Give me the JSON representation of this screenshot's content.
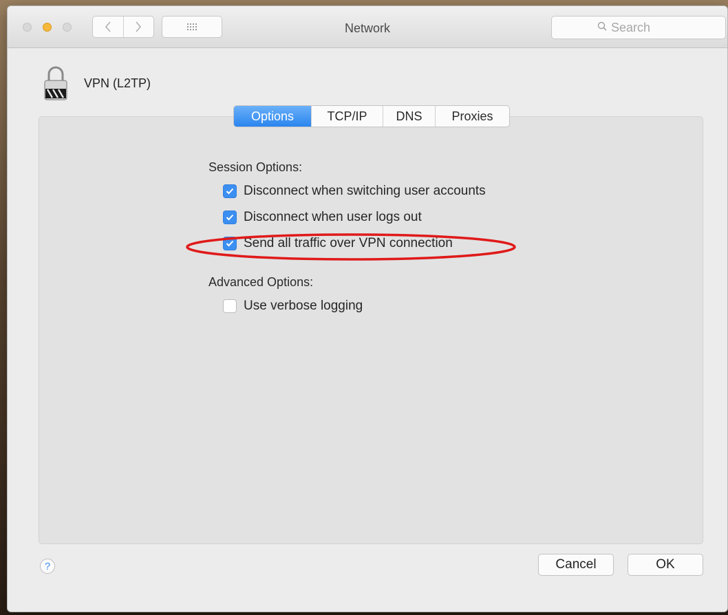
{
  "window": {
    "title": "Network"
  },
  "search": {
    "placeholder": "Search"
  },
  "service": {
    "name": "VPN (L2TP)"
  },
  "tabs": [
    {
      "label": "Options",
      "active": true
    },
    {
      "label": "TCP/IP",
      "active": false
    },
    {
      "label": "DNS",
      "active": false
    },
    {
      "label": "Proxies",
      "active": false
    }
  ],
  "session": {
    "label": "Session Options:",
    "items": [
      {
        "label": "Disconnect when switching user accounts",
        "checked": true
      },
      {
        "label": "Disconnect when user logs out",
        "checked": true
      },
      {
        "label": "Send all traffic over VPN connection",
        "checked": true
      }
    ]
  },
  "advanced": {
    "label": "Advanced Options:",
    "items": [
      {
        "label": "Use verbose logging",
        "checked": false
      }
    ]
  },
  "footer": {
    "help": "?",
    "cancel": "Cancel",
    "ok": "OK"
  },
  "colors": {
    "accent": "#2a85ef",
    "highlight": "#e01a1a",
    "minimize": "#f5b83a"
  }
}
